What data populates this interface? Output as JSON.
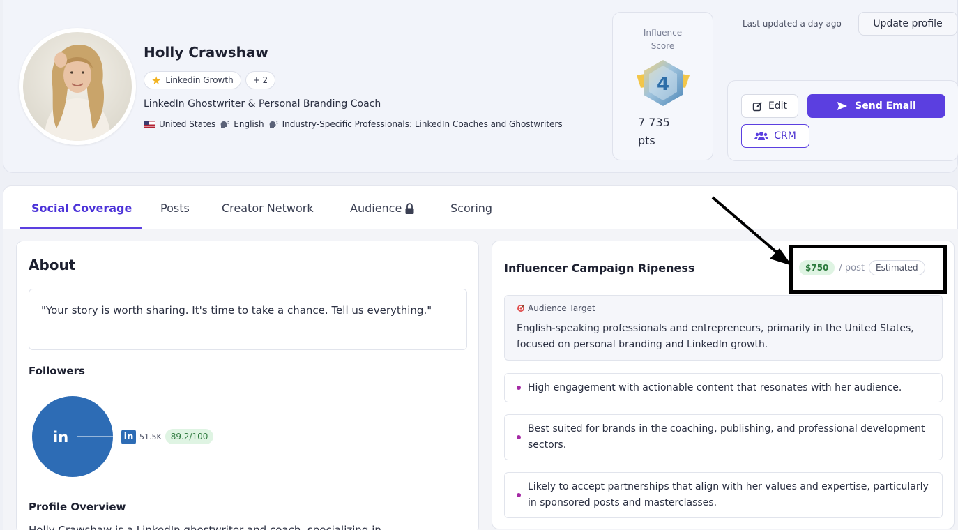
{
  "profile": {
    "name": "Holly Crawshaw",
    "tags": [
      "Linkedin Growth",
      "+ 2"
    ],
    "role": "LinkedIn Ghostwriter & Personal Branding Coach",
    "country": "United States",
    "language": "English",
    "category": "Industry-Specific Professionals: LinkedIn Coaches and Ghostwriters"
  },
  "score": {
    "label_line1": "Influence",
    "label_line2": "Score",
    "level": "4",
    "points_value": "7 735",
    "points_unit": "pts"
  },
  "header": {
    "last_updated": "Last updated a day ago",
    "update_label": "Update profile",
    "edit_label": "Edit",
    "send_label": "Send Email",
    "crm_label": "CRM"
  },
  "tabs": [
    {
      "label": "Social Coverage",
      "active": true
    },
    {
      "label": "Posts",
      "active": false
    },
    {
      "label": "Creator Network",
      "active": false
    },
    {
      "label": "Audience",
      "active": false
    },
    {
      "label": "Scoring",
      "active": false
    }
  ],
  "about": {
    "title": "About",
    "quote": "\"Your story is worth sharing. It's time to take a chance. Tell us everything.\"",
    "followers_title": "Followers",
    "linkedin_followers": "51.5K",
    "linkedin_score": "89.2/100",
    "linkedin_share": 1.0,
    "overview_title": "Profile Overview",
    "overview_text": "Holly Crawshaw is a LinkedIn ghostwriter and coach, specializing in"
  },
  "ripeness": {
    "title": "Influencer Campaign Ripeness",
    "price": "$750",
    "per_post": "/ post",
    "estimated": "Estimated",
    "target_label": "Audience Target",
    "target_text": "English-speaking professionals and entrepreneurs, primarily in the United States, focused on personal branding and LinkedIn growth.",
    "points": [
      "High engagement with actionable content that resonates with her audience.",
      "Best suited for brands in the coaching, publishing, and professional development sectors.",
      "Likely to accept partnerships that align with her values and expertise, particularly in sponsored posts and masterclasses."
    ]
  },
  "colors": {
    "accent": "#5b3fe0",
    "linkedin": "#2d6cb5",
    "score_green": "#dff4e3"
  },
  "icons": [
    "star-icon",
    "us-flag-icon",
    "speaking-head-icon",
    "edit-icon",
    "send-icon",
    "users-icon",
    "lock-icon",
    "target-icon",
    "linkedin-icon"
  ]
}
